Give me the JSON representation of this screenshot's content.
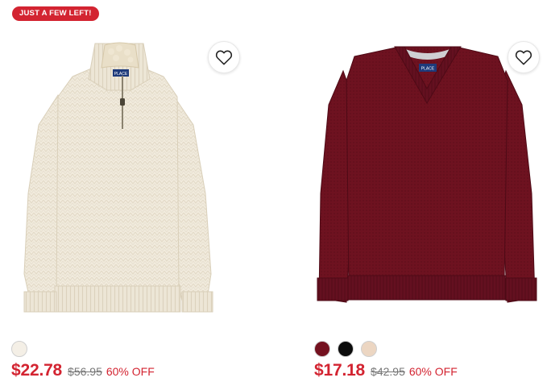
{
  "products": [
    {
      "badge": "JUST A FEW LEFT!",
      "image_alt": "Cream quarter-zip sweater",
      "brand_tag": "PLACE",
      "wishlist_icon": "heart-outline-icon",
      "swatches": [
        "#f4efe6"
      ],
      "sale_price": "$22.78",
      "original_price": "$56.95",
      "discount": "60% OFF"
    },
    {
      "image_alt": "Burgundy V-neck sweater",
      "brand_tag": "PLACE",
      "wishlist_icon": "heart-outline-icon",
      "swatches": [
        "#74111f",
        "#0c0c0c",
        "#ecd6c2"
      ],
      "sale_price": "$17.18",
      "original_price": "$42.95",
      "discount": "60% OFF"
    }
  ],
  "colors": {
    "accent_red": "#d32431",
    "sweater_cream": "#f1ebdd",
    "sweater_burgundy": "#6e1220"
  }
}
